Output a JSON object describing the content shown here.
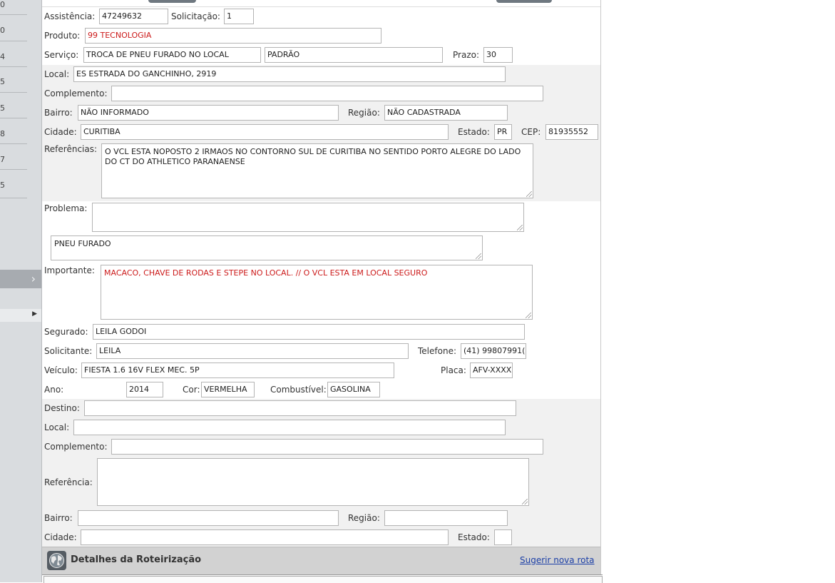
{
  "sidebar": {
    "numbers": [
      "0",
      "0",
      "4",
      "5",
      "5",
      "8",
      "7",
      "5"
    ],
    "collapse_icon": "chevron-right-icon",
    "row_icon": "caret-right-icon"
  },
  "form": {
    "assistencia": {
      "label": "Assistência:",
      "value": "47249632"
    },
    "solicitacao": {
      "label": "Solicitação:",
      "value": "1"
    },
    "produto": {
      "label": "Produto:",
      "value": "99 TECNOLOGIA"
    },
    "servico": {
      "label": "Serviço:",
      "value": "TROCA DE PNEU FURADO NO LOCAL",
      "value2": "PADRÃO"
    },
    "prazo": {
      "label": "Prazo:",
      "value": "30"
    },
    "local": {
      "label": "Local:",
      "value": "ES ESTRADA DO GANCHINHO, 2919"
    },
    "complemento": {
      "label": "Complemento:",
      "value": ""
    },
    "bairro": {
      "label": "Bairro:",
      "value": "NÃO INFORMADO"
    },
    "regiao": {
      "label": "Região:",
      "value": "NÃO CADASTRADA"
    },
    "cidade": {
      "label": "Cidade:",
      "value": "CURITIBA"
    },
    "estado": {
      "label": "Estado:",
      "value": "PR"
    },
    "cep": {
      "label": "CEP:",
      "value": "81935552"
    },
    "referencias": {
      "label": "Referências:",
      "value": "O VCL ESTA NOPOSTO 2 IRMAOS NO CONTORNO SUL DE CURITIBA NO SENTIDO PORTO ALEGRE DO LADO DO CT DO ATHLETICO PARANAENSE"
    },
    "problema": {
      "label": "Problema:",
      "value": "",
      "detail": "PNEU FURADO"
    },
    "importante": {
      "label": "Importante:",
      "value": "MACACO, CHAVE DE RODAS E STEPE NO LOCAL. // O VCL ESTA EM LOCAL SEGURO"
    },
    "segurado": {
      "label": "Segurado:",
      "value": "LEILA GODOI"
    },
    "solicitante": {
      "label": "Solicitante:",
      "value": "LEILA"
    },
    "telefone": {
      "label": "Telefone:",
      "value": "(41) 99807991("
    },
    "veiculo": {
      "label": "Veículo:",
      "value": "FIESTA 1.6 16V FLEX MEC. 5P"
    },
    "placa": {
      "label": "Placa:",
      "value": "AFV-XXXX"
    },
    "ano": {
      "label": "Ano:",
      "value": "2014"
    },
    "cor": {
      "label": "Cor:",
      "value": "VERMELHA"
    },
    "combustivel": {
      "label": "Combustível:",
      "value": "GASOLINA"
    }
  },
  "destino": {
    "destino": {
      "label": "Destino:",
      "value": ""
    },
    "local": {
      "label": "Local:",
      "value": ""
    },
    "complemento": {
      "label": "Complemento:",
      "value": ""
    },
    "referencia": {
      "label": "Referência:",
      "value": ""
    },
    "bairro": {
      "label": "Bairro:",
      "value": ""
    },
    "regiao": {
      "label": "Região:",
      "value": ""
    },
    "cidade": {
      "label": "Cidade:",
      "value": ""
    },
    "estado": {
      "label": "Estado:",
      "value": ""
    }
  },
  "footer": {
    "icon": "globe-icon",
    "title": "Detalhes da Roteirização",
    "link": "Sugerir nova rota"
  },
  "colors": {
    "red_text": "#cc1a1a",
    "link": "#1a3ea6",
    "sidebar_bg": "#d9dcdf",
    "band_bg": "#f1f1f1",
    "footer_bg": "#d2d2d2"
  }
}
